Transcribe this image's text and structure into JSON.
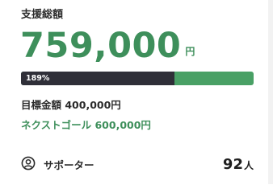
{
  "funding": {
    "title": "支援総額",
    "amount": "759,000",
    "amount_unit": "円",
    "progress_label": "189%",
    "progress_fraction": 0.66,
    "goal_text": "目標金額 400,000円",
    "next_goal_text": "ネクストゴール 600,000円"
  },
  "supporters": {
    "icon": "person-circle-icon",
    "label": "サポーター",
    "count": "92",
    "count_unit": "人"
  },
  "colors": {
    "accent_green": "#3e8f5b",
    "bar_green": "#49a065",
    "bar_dark": "#2f2f38"
  }
}
